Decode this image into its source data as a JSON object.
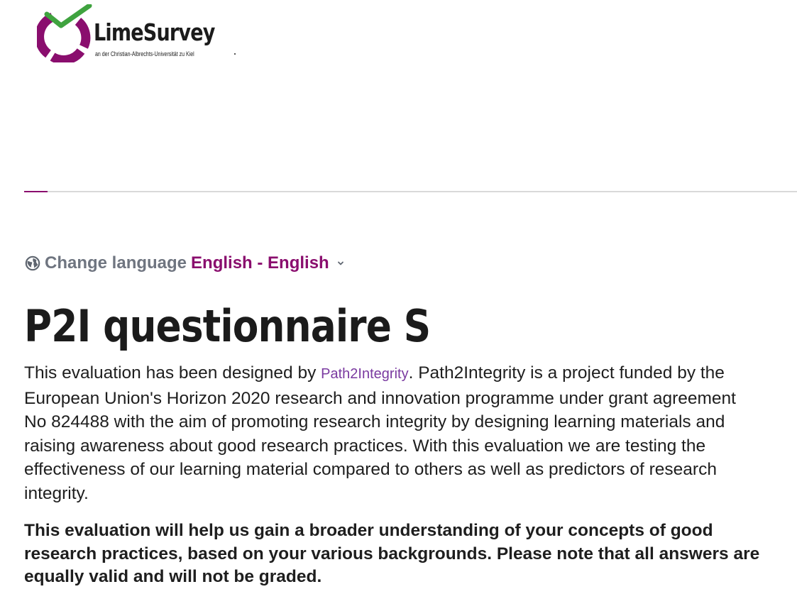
{
  "logo": {
    "title": "LimeSurvey",
    "subtitle": "an der Christian-Albrechts-Universität zu Kiel",
    "colors": {
      "ring": "#8a0e6e",
      "check": "#3fa33f"
    }
  },
  "progress": {
    "percent": 3,
    "color": "#8a0e6e"
  },
  "language": {
    "icon": "globe-icon",
    "label": "Change language",
    "selected": "English - English"
  },
  "survey": {
    "title": "P2I questionnaire S",
    "description": {
      "before_link": "This evaluation has been designed by ",
      "link_text": "Path2Integrity",
      "after_link": ". Path2Integrity is a project funded by the European Union's Horizon 2020 research and innovation pro­gramme under grant agreement No 824488 with the aim of promoting research in­tegrity by designing learning materials and raising awareness about good research practices. With this evaluation we are testing the effectiveness of our learning ma­terial compared to others as well as predictors of research integrity."
    },
    "highlight": "This evaluation will help us gain a broader understanding of your concepts of good research practices, based on your various backgrounds. Please note that all answers are equally valid and will not be graded."
  }
}
